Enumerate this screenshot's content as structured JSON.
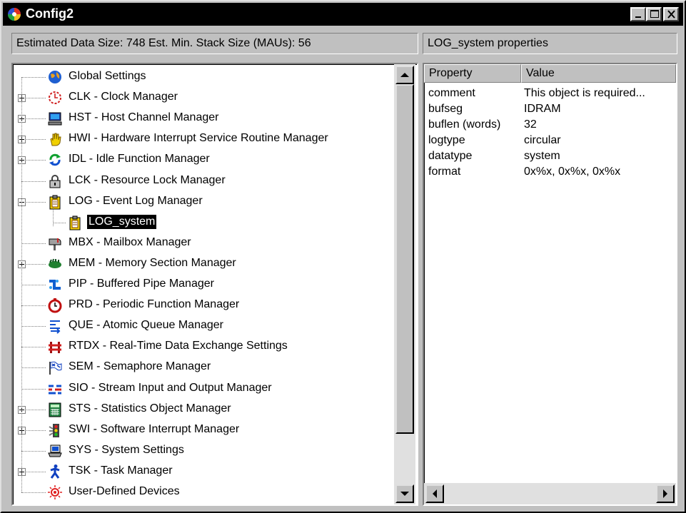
{
  "window": {
    "title": "Config2"
  },
  "left": {
    "header": "Estimated Data Size: 748   Est. Min. Stack Size (MAUs): 56",
    "tree": [
      {
        "label": "Global Settings",
        "icon": "globe-icon",
        "expander": "none",
        "depth": 0
      },
      {
        "label": "CLK - Clock Manager",
        "icon": "clock-icon",
        "expander": "plus",
        "depth": 0
      },
      {
        "label": "HST - Host Channel Manager",
        "icon": "computer-icon",
        "expander": "plus",
        "depth": 0
      },
      {
        "label": "HWI - Hardware Interrupt Service Routine Manager",
        "icon": "hand-icon",
        "expander": "plus",
        "depth": 0
      },
      {
        "label": "IDL - Idle Function Manager",
        "icon": "cycle-arrows-icon",
        "expander": "plus",
        "depth": 0
      },
      {
        "label": "LCK - Resource Lock Manager",
        "icon": "padlock-icon",
        "expander": "none",
        "depth": 0
      },
      {
        "label": "LOG - Event Log Manager",
        "icon": "clipboard-icon",
        "expander": "minus",
        "depth": 0
      },
      {
        "label": "LOG_system",
        "icon": "clipboard-icon",
        "expander": "none",
        "depth": 1,
        "selected": true
      },
      {
        "label": "MBX - Mailbox Manager",
        "icon": "mailbox-icon",
        "expander": "none",
        "depth": 0
      },
      {
        "label": "MEM - Memory Section Manager",
        "icon": "memory-chip-icon",
        "expander": "plus",
        "depth": 0
      },
      {
        "label": "PIP - Buffered Pipe Manager",
        "icon": "pipe-icon",
        "expander": "none",
        "depth": 0
      },
      {
        "label": "PRD - Periodic Function Manager",
        "icon": "stopwatch-icon",
        "expander": "none",
        "depth": 0
      },
      {
        "label": "QUE - Atomic Queue Manager",
        "icon": "queue-icon",
        "expander": "none",
        "depth": 0
      },
      {
        "label": "RTDX - Real-Time Data Exchange Settings",
        "icon": "rtdx-icon",
        "expander": "none",
        "depth": 0
      },
      {
        "label": "SEM - Semaphore Manager",
        "icon": "flag-icon",
        "expander": "none",
        "depth": 0
      },
      {
        "label": "SIO - Stream Input and Output Manager",
        "icon": "stream-icon",
        "expander": "none",
        "depth": 0
      },
      {
        "label": "STS - Statistics Object Manager",
        "icon": "calculator-icon",
        "expander": "plus",
        "depth": 0
      },
      {
        "label": "SWI - Software Interrupt Manager",
        "icon": "traffic-light-icon",
        "expander": "plus",
        "depth": 0
      },
      {
        "label": "SYS - System Settings",
        "icon": "laptop-icon",
        "expander": "none",
        "depth": 0
      },
      {
        "label": "TSK - Task Manager",
        "icon": "running-figure-icon",
        "expander": "plus",
        "depth": 0
      },
      {
        "label": "User-Defined Devices",
        "icon": "starburst-icon",
        "expander": "none",
        "depth": 0
      }
    ]
  },
  "right": {
    "header": "LOG_system properties",
    "columns": [
      "Property",
      "Value"
    ],
    "rows": [
      {
        "property": "comment",
        "value": "This object is required..."
      },
      {
        "property": "bufseg",
        "value": "IDRAM"
      },
      {
        "property": "buflen (words)",
        "value": "32"
      },
      {
        "property": "logtype",
        "value": "circular"
      },
      {
        "property": "datatype",
        "value": "system"
      },
      {
        "property": "format",
        "value": "0x%x, 0x%x, 0x%x"
      }
    ]
  },
  "colors": {
    "face": "#c0c0c0",
    "titlebar": "#000000",
    "selection": "#000000"
  }
}
